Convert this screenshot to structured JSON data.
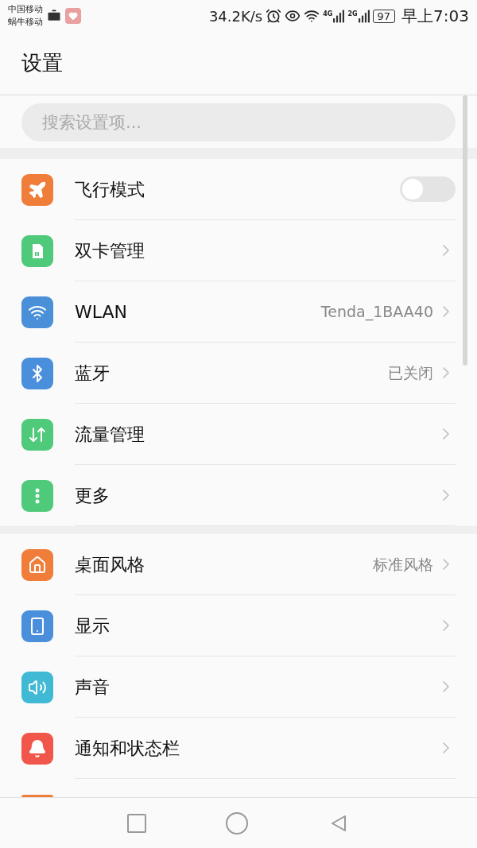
{
  "status_bar": {
    "carriers": [
      "中国移动",
      "蜗牛移动"
    ],
    "speed": "34.2K/s",
    "network_labels": [
      "4G",
      "2G"
    ],
    "battery": "97",
    "time": "早上7:03"
  },
  "header": {
    "title": "设置"
  },
  "search": {
    "placeholder": "搜索设置项..."
  },
  "groups": [
    {
      "items": [
        {
          "label": "飞行模式",
          "color": "#f07d3a",
          "kind": "toggle",
          "on": false
        },
        {
          "label": "双卡管理",
          "color": "#4fc97a",
          "kind": "link"
        },
        {
          "label": "WLAN",
          "color": "#4a90d9",
          "kind": "link",
          "value": "Tenda_1BAA40"
        },
        {
          "label": "蓝牙",
          "color": "#4a8fdc",
          "kind": "link",
          "value": "已关闭"
        },
        {
          "label": "流量管理",
          "color": "#4fc97a",
          "kind": "link"
        },
        {
          "label": "更多",
          "color": "#4fc97a",
          "kind": "link"
        }
      ]
    },
    {
      "items": [
        {
          "label": "桌面风格",
          "color": "#f07d3a",
          "kind": "link",
          "value": "标准风格"
        },
        {
          "label": "显示",
          "color": "#4a8fdc",
          "kind": "link"
        },
        {
          "label": "声音",
          "color": "#3fb9d4",
          "kind": "link"
        },
        {
          "label": "通知和状态栏",
          "color": "#f0564a",
          "kind": "link"
        }
      ]
    }
  ]
}
